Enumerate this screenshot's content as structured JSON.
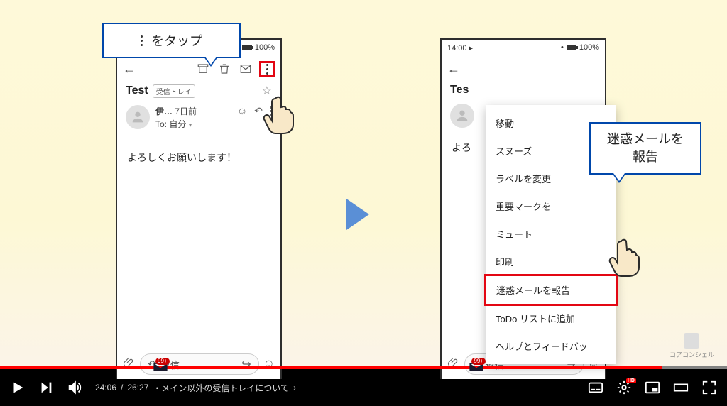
{
  "callouts": {
    "left": "をタップ",
    "right": "迷惑メールを\n報告"
  },
  "phone_left": {
    "time": "",
    "battery": "100%",
    "subject": "Test",
    "inbox_label": "受信トレイ",
    "sender": "伊…",
    "date": "7日前",
    "to": "To: 自分",
    "body": "よろしくお願いします！",
    "reply": "返信"
  },
  "phone_right": {
    "time": "14:00",
    "battery": "100%",
    "subject": "Tes",
    "sender_initial": "",
    "body_peek": "よろ",
    "reply": "返信",
    "menu": [
      "移動",
      "スヌーズ",
      "ラベルを変更",
      "重要マークを",
      "ミュート",
      "印刷",
      "迷惑メールを報告",
      "ToDo リストに追加",
      "ヘルプとフィードバッ"
    ]
  },
  "logo_text": "コアコンシェル",
  "player": {
    "current": "24:06",
    "total": "26:27",
    "chapter": "・メイン以外の受信トレイについて",
    "hd": "HD",
    "progress_pct": 91,
    "marker1_pct": 21.5,
    "marker2_pct": 65.2,
    "badge": "99+"
  }
}
